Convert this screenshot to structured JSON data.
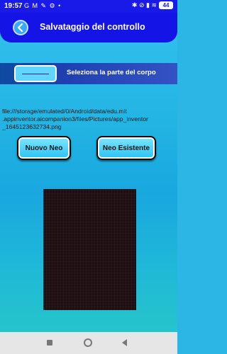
{
  "status_bar": {
    "time": "19:57",
    "left_icons": [
      "google-icon",
      "gmail-icon",
      "wrench-icon",
      "settings-icon",
      "dot"
    ],
    "left_icons_text": "G M ✎ ⚙ •",
    "right_icons": [
      "bluetooth-icon",
      "silent-icon",
      "signal-icon",
      "wifi-icon"
    ],
    "right_icons_text": "✱ ⊘ ▮ ≋",
    "battery": "44"
  },
  "app_bar": {
    "title": "Salvataggio del controllo",
    "color": "#1414e6"
  },
  "body_part": {
    "button_label": "———",
    "label": "Seleziona la parte del corpo"
  },
  "file_path": {
    "lines": [
      "file:///storage/emulated/0/Android/data/edu.mit",
      ".appinventor.aicompanion3/files/Pictures/app_inventor",
      "_1645123632734.png"
    ]
  },
  "buttons": {
    "new_mole": "Nuovo Neo",
    "existing_mole": "Neo Esistente"
  },
  "nav_bar": {
    "icons": [
      "recents-icon",
      "home-icon",
      "back-icon"
    ]
  }
}
